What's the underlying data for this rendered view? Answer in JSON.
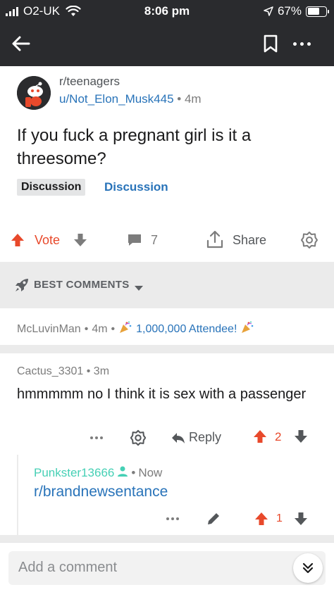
{
  "status_bar": {
    "carrier": "O2-UK",
    "time": "8:06 pm",
    "battery_percent": "67%",
    "battery_level": 0.67
  },
  "nav": {
    "back_icon": "arrow-left-icon",
    "save_icon": "bookmark-icon",
    "more_icon": "more-horizontal-icon"
  },
  "post": {
    "subreddit": "r/teenagers",
    "author": "u/Not_Elon_Musk445",
    "age": "4m",
    "title": "If you fuck a pregnant girl is it a threesome?",
    "flair_tag": "Discussion",
    "flair_link": "Discussion"
  },
  "actions": {
    "vote_label": "Vote",
    "comment_count": "7",
    "share_label": "Share"
  },
  "sort": {
    "label": "BEST COMMENTS"
  },
  "comments": [
    {
      "author": "McLuvinMan",
      "age": "4m",
      "award_text": "1,000,000 Attendee!"
    },
    {
      "author": "Cactus_3301",
      "age": "3m",
      "body": "hmmmmm no I think it is sex with a passenger",
      "reply_label": "Reply",
      "score": "2"
    },
    {
      "author": "Punkster13666",
      "age": "Now",
      "body": "r/brandnewsentance",
      "score": "1"
    }
  ],
  "composer": {
    "placeholder": "Add a comment"
  },
  "colors": {
    "upvote": "#e8492b",
    "link": "#2873b9",
    "op_author": "#46d0b5",
    "topbar": "#2a2b2e"
  }
}
